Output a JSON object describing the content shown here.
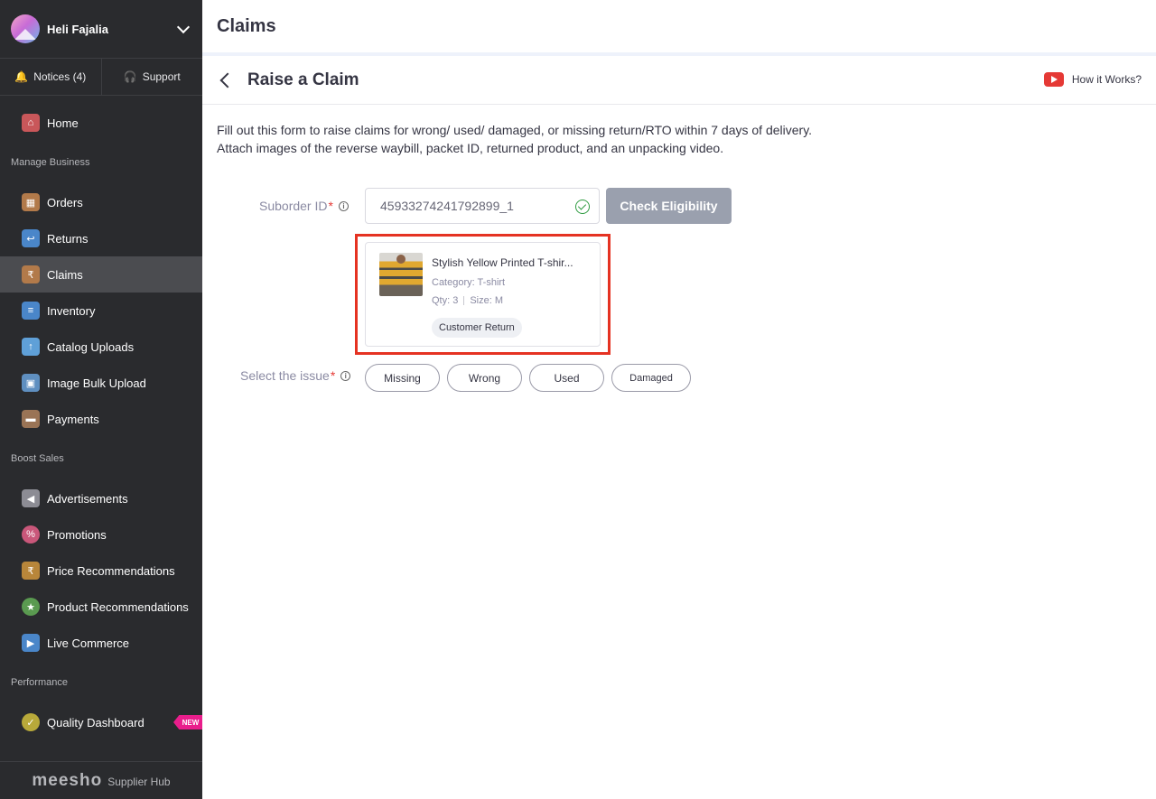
{
  "sidebar": {
    "profile_name": "Heli Fajalia",
    "notices_label": "Notices (4)",
    "support_label": "Support",
    "home_label": "Home",
    "section_manage": "Manage Business",
    "orders_label": "Orders",
    "returns_label": "Returns",
    "claims_label": "Claims",
    "inventory_label": "Inventory",
    "catalog_label": "Catalog Uploads",
    "image_bulk_label": "Image Bulk Upload",
    "payments_label": "Payments",
    "section_boost": "Boost Sales",
    "ads_label": "Advertisements",
    "promotions_label": "Promotions",
    "price_rec_label": "Price Recommendations",
    "product_rec_label": "Product Recommendations",
    "live_commerce_label": "Live Commerce",
    "section_performance": "Performance",
    "quality_label": "Quality Dashboard",
    "new_badge": "NEW",
    "brand": "meesho",
    "brand_sub": "Supplier Hub"
  },
  "header": {
    "title": "Claims",
    "subtitle": "Raise a Claim",
    "how_it_works": "How it Works?"
  },
  "form": {
    "description": "Fill out this form to raise  claims for wrong/ used/ damaged, or missing return/RTO within 7 days of delivery. Attach images of the reverse waybill, packet ID, returned product, and an unpacking video.",
    "suborder_label": "Suborder ID",
    "required_mark": "*",
    "suborder_value": "45933274241792899_1",
    "check_button": "Check Eligibility",
    "issue_label": "Select the issue",
    "issues": [
      "Missing",
      "Wrong",
      "Used",
      "Damaged"
    ]
  },
  "product": {
    "name": "Stylish Yellow Printed T-shir...",
    "category": "Category: T-shirt",
    "qty": "Qty: 3",
    "size": "Size: M",
    "tag": "Customer Return"
  },
  "colors": {
    "sidebar_bg": "#2a2b2e",
    "active_bg": "#4b4c50",
    "highlight": "#e53222",
    "button_disabled": "#9aa0ae",
    "success": "#2e9b40",
    "new_badge": "#e91e8c"
  }
}
